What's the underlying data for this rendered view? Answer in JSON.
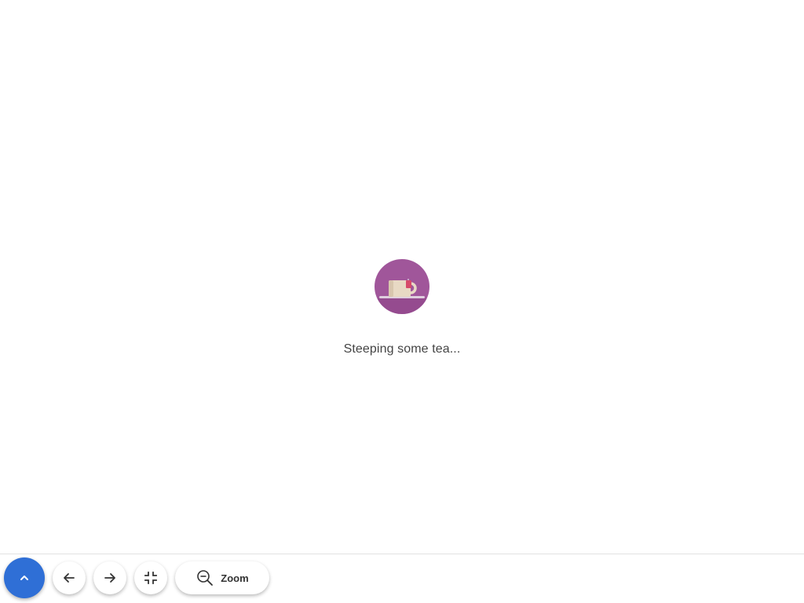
{
  "loading": {
    "message": "Steeping some tea..."
  },
  "toolbar": {
    "zoom_label": "Zoom",
    "buttons": {
      "menu_toggle": "chevron-up-icon",
      "back": "arrow-left-icon",
      "forward": "arrow-right-icon",
      "collapse": "collapse-icon",
      "zoom": "zoom-out-icon"
    }
  },
  "colors": {
    "accent": "#2f6fd6",
    "tea_badge": "#a0569a",
    "cup": "#e8d9c4",
    "tea_tag": "#d64b6a",
    "text": "#444444"
  }
}
